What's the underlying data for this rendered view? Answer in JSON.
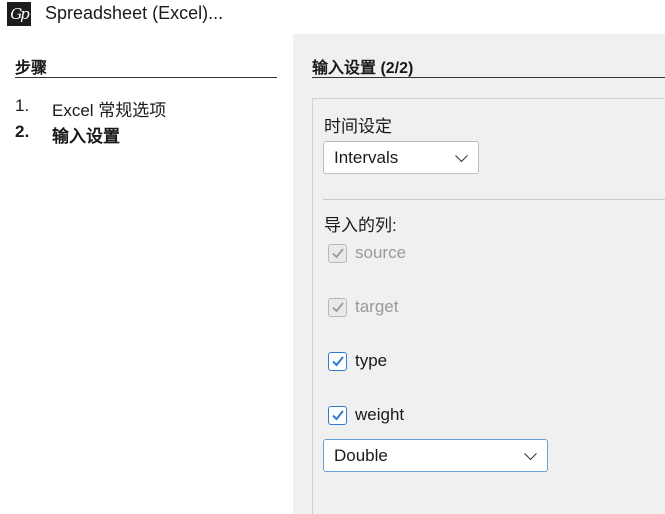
{
  "window": {
    "title": "Spreadsheet (Excel)...",
    "icon": "gephi-logo-icon"
  },
  "steps": {
    "heading": "步骤",
    "items": [
      {
        "number": "1.",
        "label": "Excel 常规选项",
        "active": false
      },
      {
        "number": "2.",
        "label": "输入设置",
        "active": true
      }
    ]
  },
  "main": {
    "heading": "输入设置 (2/2)",
    "time_label": "时间设定",
    "time_dropdown": {
      "selected": "Intervals"
    },
    "columns_label": "导入的列:",
    "columns": [
      {
        "label": "source",
        "checked": true,
        "enabled": false
      },
      {
        "label": "target",
        "checked": true,
        "enabled": false
      },
      {
        "label": "type",
        "checked": true,
        "enabled": true
      },
      {
        "label": "weight",
        "checked": true,
        "enabled": true
      }
    ],
    "weight_type_dropdown": {
      "selected": "Double"
    }
  },
  "colors": {
    "main_background": "#f0f0f0",
    "checkbox_accent": "#2e7bd6",
    "disabled_text": "#9a9a9a"
  }
}
